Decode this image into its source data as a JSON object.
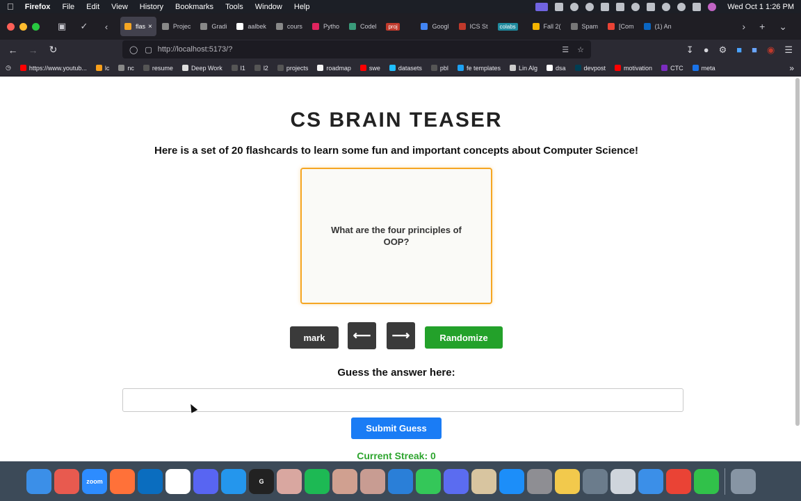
{
  "menubar": {
    "app": "Firefox",
    "items": [
      "File",
      "Edit",
      "View",
      "History",
      "Bookmarks",
      "Tools",
      "Window",
      "Help"
    ],
    "clock": "Wed Oct 1  1:26 PM"
  },
  "tabs": [
    {
      "label": "flas",
      "color": "#f5a623",
      "active": true
    },
    {
      "label": "Projec",
      "color": "#888888"
    },
    {
      "label": "Gradi",
      "color": "#888888"
    },
    {
      "label": "aalbek",
      "color": "#ffffff"
    },
    {
      "label": "cours",
      "color": "#888888"
    },
    {
      "label": "Pytho",
      "color": "#e0245e"
    },
    {
      "label": "Codel",
      "color": "#3a9b7a"
    },
    {
      "label": "proj",
      "color": "#c0392b",
      "badge": true
    },
    {
      "label": "Googl",
      "color": "#4285f4"
    },
    {
      "label": "ICS St",
      "color": "#c0392b"
    },
    {
      "label": "colabs",
      "color": "#1f8a9e",
      "badge": true
    },
    {
      "label": "Fall 2(",
      "color": "#f4b400"
    },
    {
      "label": "Spam",
      "color": "#777777"
    },
    {
      "label": "[Com",
      "color": "#ea4335"
    },
    {
      "label": "(1) An",
      "color": "#0a66c2"
    }
  ],
  "navbar": {
    "url": "http://localhost:5173/?"
  },
  "bookmarks": [
    {
      "label": "https://www.youtub...",
      "color": "#ff0000"
    },
    {
      "label": "lc",
      "color": "#f89f1b"
    },
    {
      "label": "nc",
      "color": "#888888"
    },
    {
      "label": "resume",
      "color": "#555555"
    },
    {
      "label": "Deep Work",
      "color": "#dddddd"
    },
    {
      "label": "l1",
      "color": "#555555"
    },
    {
      "label": "l2",
      "color": "#555555"
    },
    {
      "label": "projects",
      "color": "#555555"
    },
    {
      "label": "roadmap",
      "color": "#f5f5f5"
    },
    {
      "label": "swe",
      "color": "#ff0000"
    },
    {
      "label": "datasets",
      "color": "#20beff"
    },
    {
      "label": "pbl",
      "color": "#555555"
    },
    {
      "label": "fe templates",
      "color": "#1da1f2"
    },
    {
      "label": "Lin Alg",
      "color": "#cccccc"
    },
    {
      "label": "dsa",
      "color": "#ffffff"
    },
    {
      "label": "devpost",
      "color": "#003e54"
    },
    {
      "label": "motivation",
      "color": "#ff0000"
    },
    {
      "label": "CTC",
      "color": "#7b2cbf"
    },
    {
      "label": "meta",
      "color": "#1a73e8"
    }
  ],
  "page": {
    "title": "CS BRAIN TEASER",
    "subtitle": "Here is a set of 20 flashcards to learn some fun and important concepts about Computer Science!",
    "card_text": "What are the four principles of OOP?",
    "mark_label": "mark",
    "prev_label": "⟵",
    "next_label": "⟶",
    "randomize_label": "Randomize",
    "guess_label": "Guess the answer here:",
    "guess_value": "",
    "submit_label": "Submit Guess",
    "streak_text": "Current Streak: 0"
  },
  "dock": [
    {
      "name": "finder-icon",
      "color": "#3b8fe8"
    },
    {
      "name": "launchpad-icon",
      "color": "#e85a4f"
    },
    {
      "name": "zoom-icon",
      "color": "#2d8cff",
      "text": "zoom"
    },
    {
      "name": "firefox-icon",
      "color": "#ff7139"
    },
    {
      "name": "vscode-icon",
      "color": "#0a6dbf"
    },
    {
      "name": "slack-icon",
      "color": "#ffffff"
    },
    {
      "name": "discord-icon",
      "color": "#5865f2"
    },
    {
      "name": "docker-icon",
      "color": "#2496ed"
    },
    {
      "name": "goodnotes-icon",
      "color": "#222222",
      "text": "G"
    },
    {
      "name": "anime-app-icon",
      "color": "#d9a7a0"
    },
    {
      "name": "spotify-icon",
      "color": "#1db954"
    },
    {
      "name": "anime-app-2-icon",
      "color": "#d0a090"
    },
    {
      "name": "anime-app-3-icon",
      "color": "#c89c92"
    },
    {
      "name": "fortinet-icon",
      "color": "#2a7fd8"
    },
    {
      "name": "messages-icon",
      "color": "#34c759"
    },
    {
      "name": "settings-gear-icon",
      "color": "#5b6cf0"
    },
    {
      "name": "photo-icon",
      "color": "#d8c5a0"
    },
    {
      "name": "app-store-icon",
      "color": "#1c8ef9"
    },
    {
      "name": "system-settings-icon",
      "color": "#8e8e93"
    },
    {
      "name": "chrome-canary-icon",
      "color": "#f2c94c"
    },
    {
      "name": "preview-icon",
      "color": "#6b7c8c"
    },
    {
      "name": "simulator-icon",
      "color": "#cfd5dc"
    },
    {
      "name": "mail-icon",
      "color": "#3b8fe8"
    },
    {
      "name": "chrome-icon",
      "color": "#ea4335"
    },
    {
      "name": "numbers-icon",
      "color": "#31c14a"
    },
    {
      "name": "trash-icon",
      "color": "#8795a4"
    }
  ]
}
